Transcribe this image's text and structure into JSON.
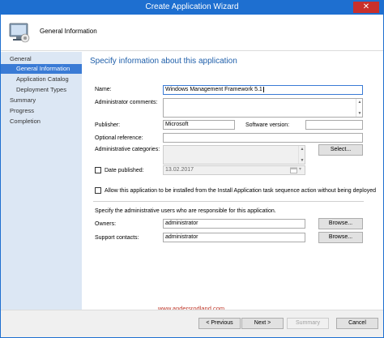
{
  "window": {
    "title": "Create Application Wizard",
    "close_glyph": "✕"
  },
  "header": {
    "title": "General Information"
  },
  "sidebar": {
    "items": [
      {
        "label": "General",
        "selected": false
      },
      {
        "label": "General Information",
        "selected": true
      },
      {
        "label": "Application Catalog",
        "selected": false
      },
      {
        "label": "Deployment Types",
        "selected": false
      },
      {
        "label": "Summary",
        "selected": false
      },
      {
        "label": "Progress",
        "selected": false
      },
      {
        "label": "Completion",
        "selected": false
      }
    ]
  },
  "main": {
    "heading": "Specify information about this application",
    "name_label": "Name:",
    "name_value": "Windows Management Framework 5.1",
    "admin_comments_label": "Administrator comments:",
    "admin_comments_value": "",
    "publisher_label": "Publisher:",
    "publisher_value": "Microsoft",
    "software_version_label": "Software version:",
    "software_version_value": "",
    "optional_reference_label": "Optional reference:",
    "optional_reference_value": "",
    "admin_categories_label": "Administrative categories:",
    "select_button": "Select...",
    "date_published_label": "Date published:",
    "date_published_value": "13.02.2017",
    "date_published_checked": false,
    "allow_install_label": "Allow this application to be installed from the Install Application task sequence action without being deployed",
    "allow_install_checked": false,
    "responsible_text": "Specify the administrative users who are responsible for this application.",
    "owners_label": "Owners:",
    "owners_value": "administrator",
    "owners_browse": "Browse...",
    "support_contacts_label": "Support contacts:",
    "support_contacts_value": "administrator",
    "support_browse": "Browse..."
  },
  "watermark": "www.andersrodland.com",
  "footer": {
    "previous": "< Previous",
    "next": "Next >",
    "summary": "Summary",
    "cancel": "Cancel"
  },
  "colors": {
    "accent": "#1e6fd0",
    "heading": "#1f5faa",
    "sidebar_bg": "#dce7f4",
    "selected": "#3a7bd5",
    "close": "#c9302c"
  }
}
